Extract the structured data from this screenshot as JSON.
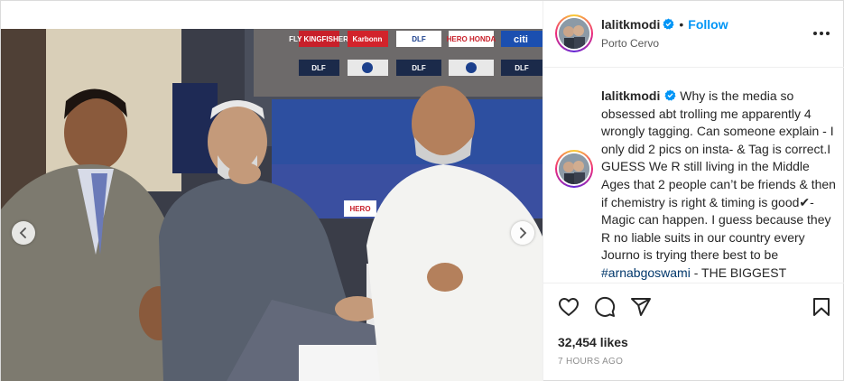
{
  "post": {
    "username": "lalitkmodi",
    "follow_label": "Follow",
    "separator": "•",
    "location": "Porto Cervo",
    "caption_text": " Why is the media so obsessed abt trolling me apparently 4 wrongly tagging. Can someone explain - I only did 2 pics on insta- & Tag is correct.I GUESS We R still living in the Middle Ages that 2 people can’t be friends & then if chemistry is right & timing is good✔- Magic can happen. I guess because they R no liable suits in our country every Journo is trying there best to be ",
    "hashtag": "#arnabgoswami",
    "caption_tail": " - THE BIGGEST CLOWN. My advise live and Let live",
    "likes": "32,454 likes",
    "timestamp": "7 HOURS AGO"
  },
  "media": {
    "banners": [
      "FLY KINGFISHER",
      "Karbonn",
      "DLF",
      "HERO HONDA",
      "citi",
      "DLF",
      "DLF",
      "DLF",
      "HERO"
    ],
    "slide_count": 11,
    "active_slide": 7
  },
  "icons": {
    "verified": "verified-badge-icon",
    "more": "more-options-icon",
    "like": "heart-icon",
    "comment": "comment-icon",
    "share": "paper-plane-icon",
    "save": "bookmark-icon",
    "prev": "chevron-left-icon",
    "next": "chevron-right-icon"
  },
  "colors": {
    "follow": "#0095f6",
    "verified": "#0095f6",
    "hashtag": "#00376b",
    "muted": "#8e8e8e"
  }
}
